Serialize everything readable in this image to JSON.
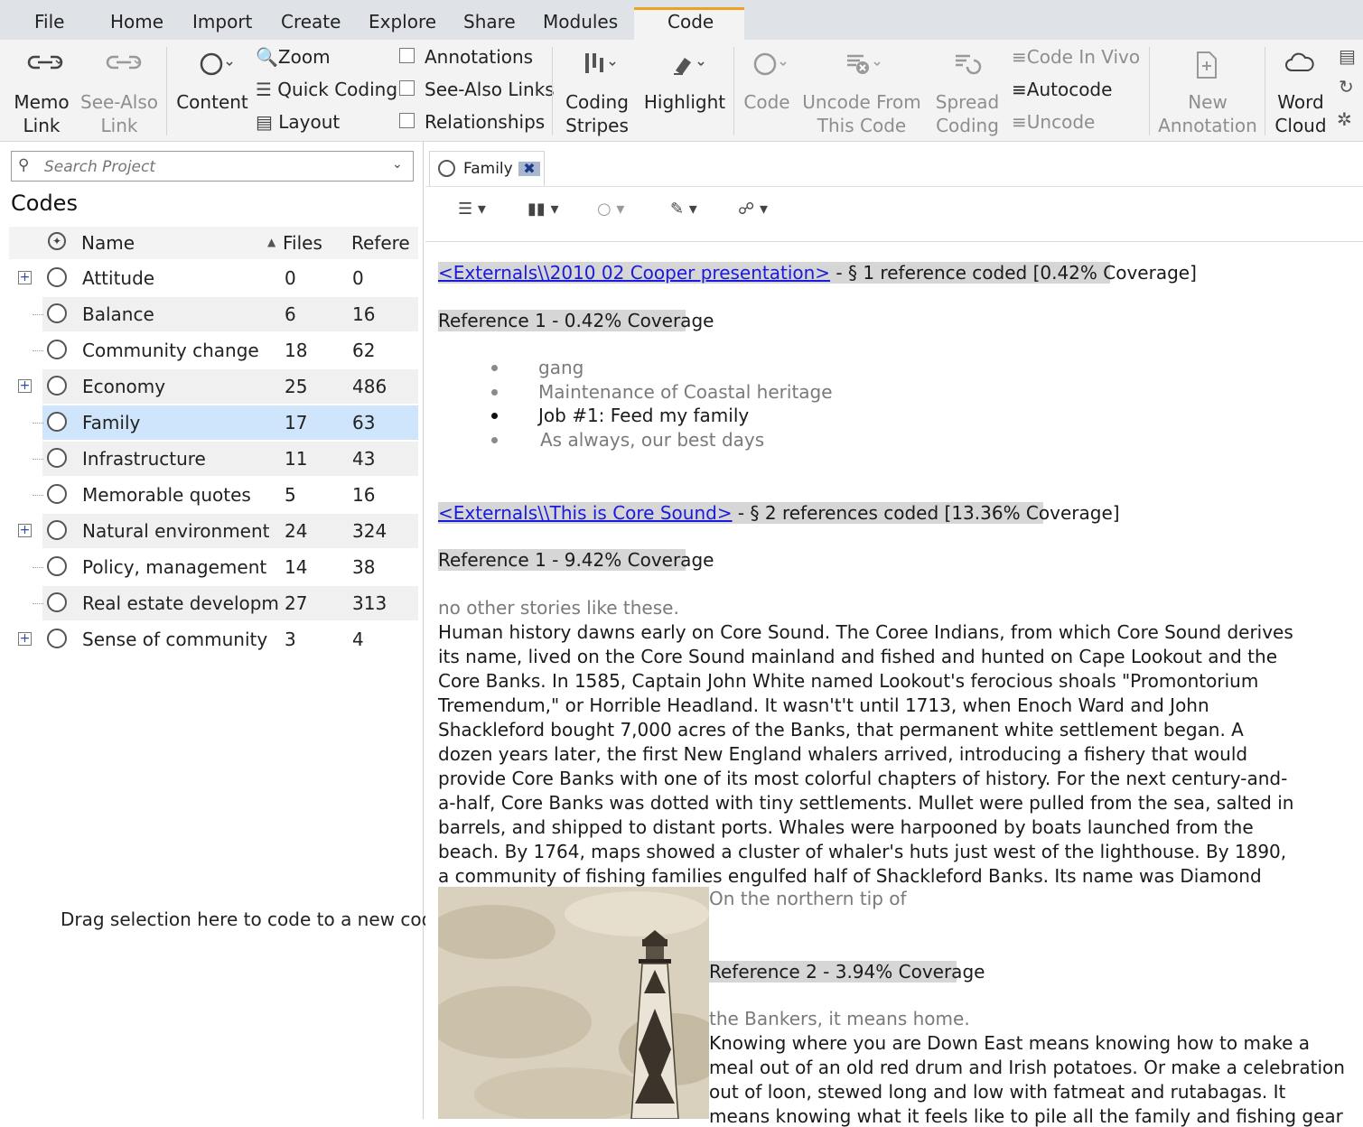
{
  "menu": {
    "items": [
      "File",
      "Home",
      "Import",
      "Create",
      "Explore",
      "Share",
      "Modules",
      "Code"
    ],
    "active": "Code"
  },
  "ribbon": {
    "memo_link": [
      "Memo",
      "Link"
    ],
    "see_also_link": [
      "See-Also",
      "Link"
    ],
    "content": "Content",
    "zoom": "Zoom",
    "quick_coding": "Quick Coding",
    "layout": "Layout",
    "annotations": "Annotations",
    "see_also_links": "See-Also Links",
    "relationships": "Relationships",
    "coding_stripes": [
      "Coding",
      "Stripes"
    ],
    "highlight": "Highlight",
    "code": "Code",
    "uncode_from": [
      "Uncode From",
      "This Code"
    ],
    "spread_coding": [
      "Spread",
      "Coding"
    ],
    "code_in_vivo": "Code In Vivo",
    "autocode": "Autocode",
    "uncode": "Uncode",
    "new_annotation": [
      "New",
      "Annotation"
    ],
    "word_cloud": [
      "Word",
      "Cloud"
    ]
  },
  "left": {
    "search_placeholder": "Search Project",
    "title": "Codes",
    "columns": {
      "name": "Name",
      "files": "Files",
      "refs": "Refere"
    },
    "codes": [
      {
        "name": "Attitude",
        "files": "0",
        "refs": "0",
        "expandable": true
      },
      {
        "name": "Balance",
        "files": "6",
        "refs": "16",
        "expandable": false
      },
      {
        "name": "Community change",
        "files": "18",
        "refs": "62",
        "expandable": false
      },
      {
        "name": "Economy",
        "files": "25",
        "refs": "486",
        "expandable": true
      },
      {
        "name": "Family",
        "files": "17",
        "refs": "63",
        "expandable": false,
        "selected": true
      },
      {
        "name": "Infrastructure",
        "files": "11",
        "refs": "43",
        "expandable": false
      },
      {
        "name": "Memorable quotes",
        "files": "5",
        "refs": "16",
        "expandable": false
      },
      {
        "name": "Natural environment",
        "files": "24",
        "refs": "324",
        "expandable": true
      },
      {
        "name": "Policy, management",
        "files": "14",
        "refs": "38",
        "expandable": false
      },
      {
        "name": "Real estate developm",
        "files": "27",
        "refs": "313",
        "expandable": false
      },
      {
        "name": "Sense of community",
        "files": "3",
        "refs": "4",
        "expandable": true
      }
    ],
    "drag_hint": "Drag selection here to code to a new code"
  },
  "right": {
    "tab_label": "Family",
    "source1": {
      "link": "<Externals\\\\2010 02 Cooper presentation>",
      "summary": " - § 1 reference coded  [0.42% Coverage]",
      "ref_header": "Reference 1 - 0.42% Coverage",
      "bullets": [
        "gang",
        "Maintenance of Coastal heritage",
        "Job #1: Feed my family",
        "As always, our best days"
      ]
    },
    "source2": {
      "link": "<Externals\\\\This is Core Sound>",
      "summary": " - § 2 references coded  [13.36% Coverage]",
      "ref1_header": "Reference 1 - 9.42% Coverage",
      "context_before": "no other stories like these.",
      "paragraph": "Human history dawns early on Core Sound. The Coree Indians, from which Core Sound derives its name, lived on the Core Sound mainland and fished and hunted on Cape Lookout and the Core Banks. In 1585, Captain John White named Lookout's ferocious shoals \"Promontorium Tremendum,\" or Horrible Headland. It wasn't't until 1713, when Enoch Ward and John Shackleford bought 7,000 acres of the Banks, that permanent white settlement began. A dozen years later, the first New England whalers arrived, introducing a fishery that would provide Core Banks with one of its most colorful chapters of history. For the next century-and-a-half, Core Banks was dotted with tiny settlements. Mullet were pulled from the sea, salted in barrels, and shipped to distant ports. Whales were harpooned by boats launched from the beach. By 1764, maps showed a cluster of whaler's huts just west of the lighthouse. By 1890, a community of fishing families engulfed half of Shackleford Banks. Its name was Diamond City.",
      "context_after": "On the northern tip of",
      "ref2_header": "Reference 2 - 3.94% Coverage",
      "context_before2": "the Bankers, it means home.",
      "paragraph2_lines": [
        "Knowing where you are Down East means knowing how to make a",
        "meal out of an old red drum and Irish potatoes. Or make a celebration",
        "out of loon, stewed long and low with fatmeat and rutabagas. It",
        "means knowing what it feels like to pile all the family and fishing gear"
      ]
    }
  }
}
